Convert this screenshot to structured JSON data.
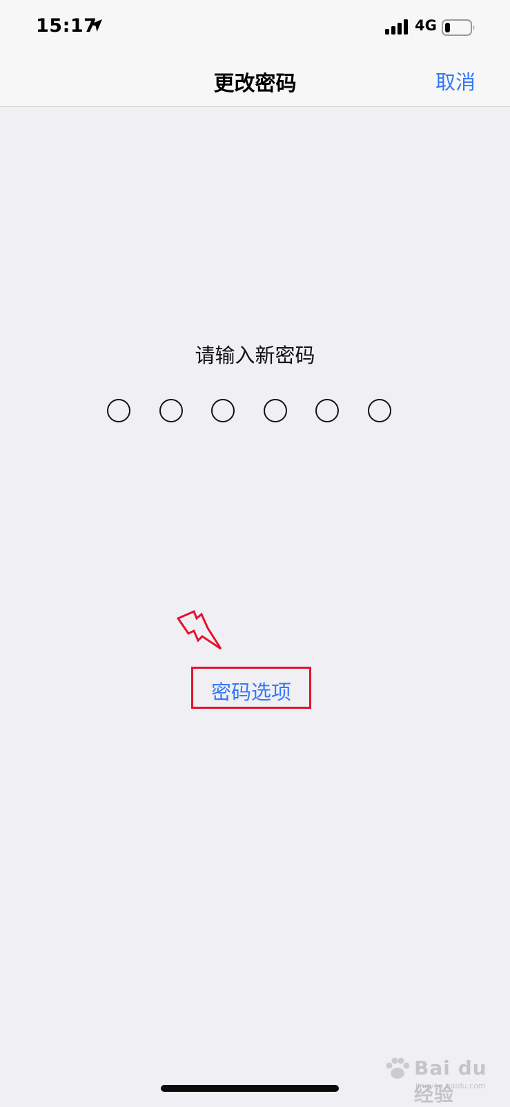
{
  "status_bar": {
    "time": "15:17",
    "network": "4G",
    "icons": {
      "location": "location-arrow-icon",
      "signal": "cellular-signal-icon",
      "battery": "battery-icon"
    },
    "battery_level": 0.2
  },
  "nav": {
    "title": "更改密码",
    "cancel_label": "取消"
  },
  "main": {
    "prompt": "请输入新密码",
    "passcode_length": 6,
    "passcode_filled": 0,
    "options_label": "密码选项"
  },
  "annotation": {
    "highlight_color": "#e3132e",
    "arrow_icon": "lightning-arrow-icon"
  },
  "watermark": {
    "brand": "Bai du 经验",
    "url": "jingyan.baidu.com"
  },
  "colors": {
    "accent": "#3478f6",
    "background": "#f0eff4",
    "bar_background": "#f7f7f7"
  }
}
